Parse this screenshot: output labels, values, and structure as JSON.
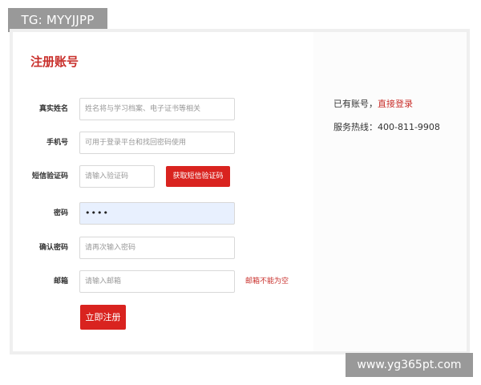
{
  "overlay_top": {
    "text": "TG: MYYJJPP"
  },
  "form": {
    "title": "注册账号",
    "fields": [
      {
        "label": "真实姓名",
        "placeholder": "姓名将与学习档案、电子证书等相关",
        "value": ""
      },
      {
        "label": "手机号",
        "placeholder": "可用于登录平台和找回密码使用",
        "value": ""
      },
      {
        "label": "短信验证码",
        "placeholder": "请输入验证码",
        "value": ""
      },
      {
        "label": "密码",
        "placeholder": "",
        "value": "••••"
      },
      {
        "label": "确认密码",
        "placeholder": "请再次输入密码",
        "value": ""
      },
      {
        "label": "邮箱",
        "placeholder": "请输入邮箱",
        "value": ""
      }
    ],
    "sms_button_label": "获取短信验证码",
    "email_error": "邮箱不能为空",
    "submit_label": "立即注册"
  },
  "side": {
    "has_account_text": "已有账号，",
    "login_link_label": "直接登录",
    "hotline_text": "服务热线：400-811-9908"
  },
  "overlay_bottom": {
    "text": "www.yg365pt.com"
  },
  "colors": {
    "accent": "#d9231f",
    "title": "#c9302c",
    "autofill_bg": "#e8f0fe"
  }
}
